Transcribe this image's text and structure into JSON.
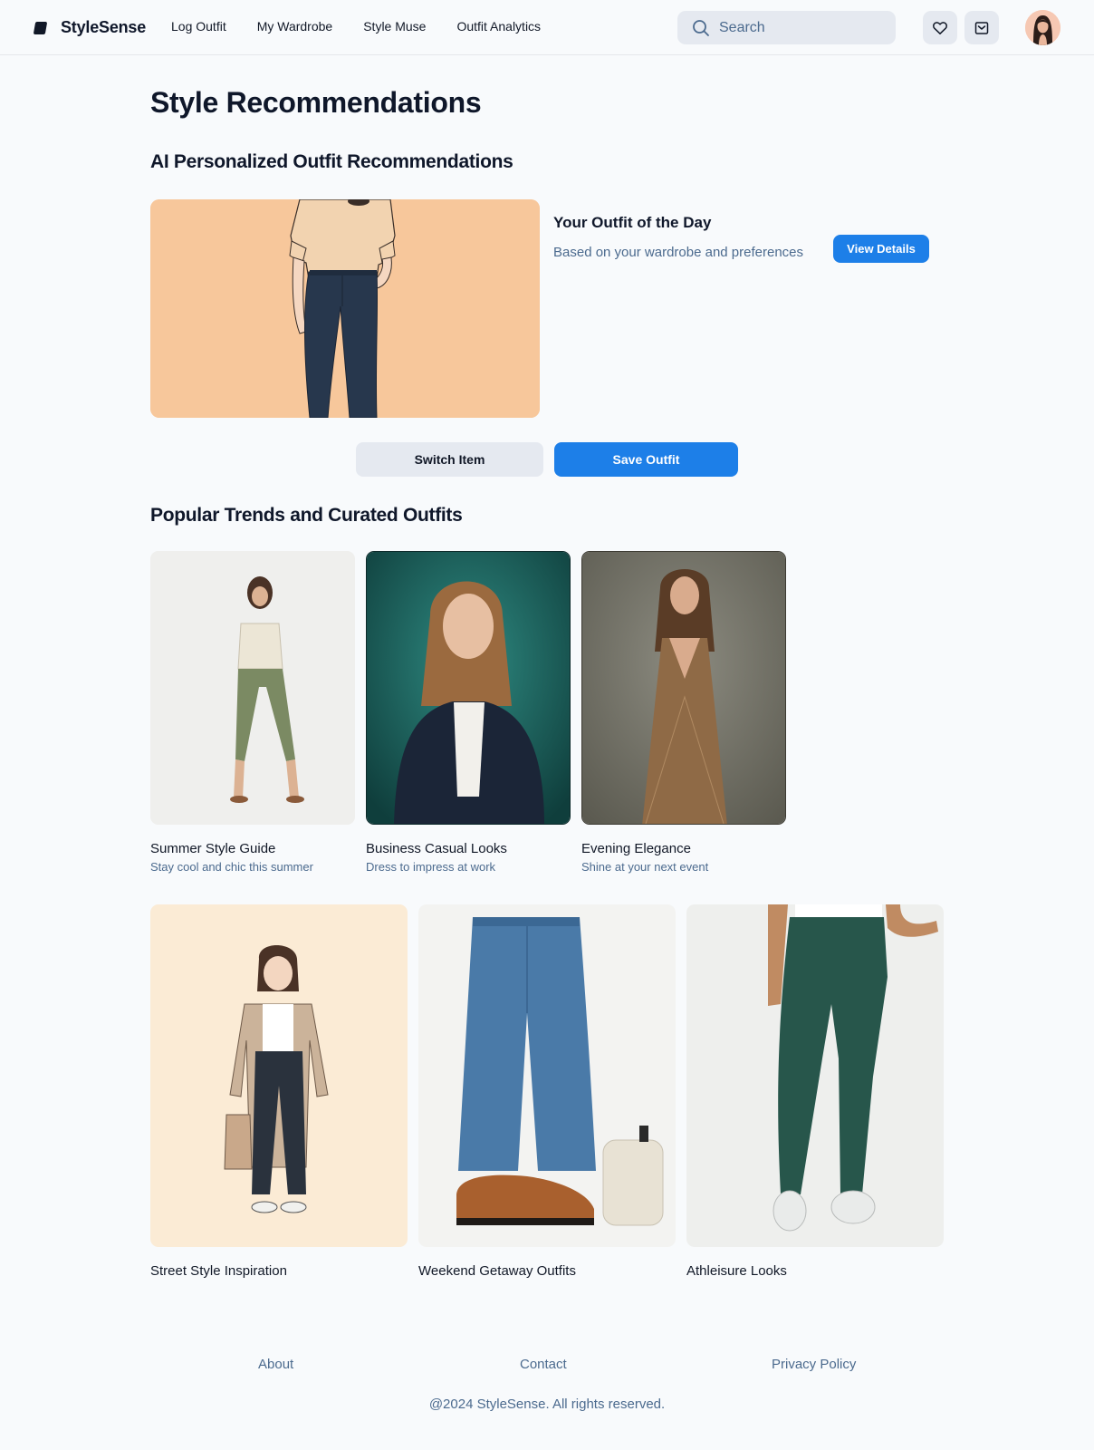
{
  "app": {
    "name": "StyleSense",
    "logo_icon": "stylesense-logo-icon"
  },
  "nav": {
    "items": [
      {
        "label": "Log Outfit"
      },
      {
        "label": "My Wardrobe"
      },
      {
        "label": "Style Muse"
      },
      {
        "label": "Outfit Analytics"
      }
    ]
  },
  "search": {
    "placeholder": "Search",
    "icon": "search-icon"
  },
  "header_actions": {
    "favorites_icon": "heart-icon",
    "inbox_icon": "inbox-icon"
  },
  "page": {
    "title": "Style Recommendations",
    "ai_section_title": "AI Personalized Outfit Recommendations",
    "trends_section_title": "Popular Trends and Curated Outfits"
  },
  "ootd": {
    "title": "Your Outfit of the Day",
    "subtitle": "Based on your wardrobe and preferences",
    "view_details_label": "View Details",
    "switch_label": "Switch Item",
    "save_label": "Save Outfit"
  },
  "trend_cards": [
    {
      "title": "Summer Style Guide",
      "subtitle": "Stay cool and chic this summer"
    },
    {
      "title": "Business Casual Looks",
      "subtitle": "Dress to impress at work"
    },
    {
      "title": "Evening Elegance",
      "subtitle": "Shine at your next event"
    }
  ],
  "curated_cards": [
    {
      "title": "Street Style Inspiration"
    },
    {
      "title": "Weekend Getaway Outfits"
    },
    {
      "title": "Athleisure Looks"
    }
  ],
  "footer": {
    "links": [
      {
        "label": "About"
      },
      {
        "label": "Contact"
      },
      {
        "label": "Privacy Policy"
      }
    ],
    "copyright": "@2024 StyleSense. All rights reserved."
  },
  "colors": {
    "accent": "#1d7fe8",
    "muted_text": "#4b6a8e",
    "surface": "#e5e9f0",
    "background": "#f8fafc"
  }
}
